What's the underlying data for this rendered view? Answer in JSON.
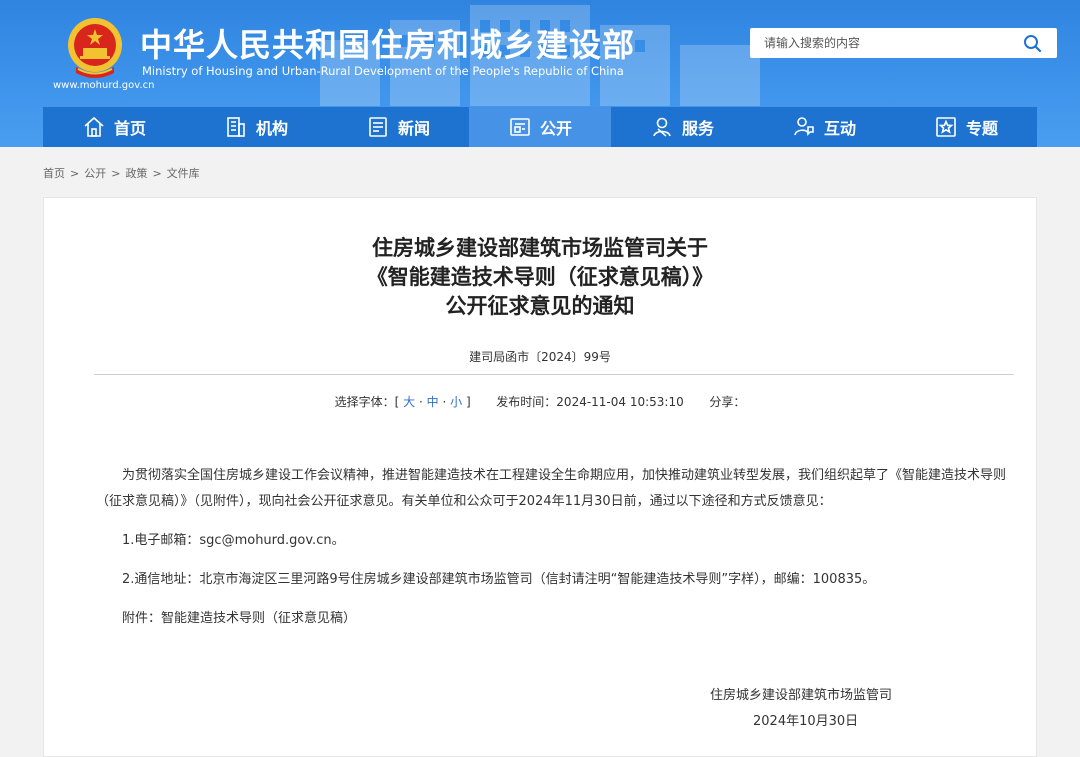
{
  "header": {
    "title": "中华人民共和国住房和城乡建设部",
    "subtitle": "Ministry of Housing and Urban-Rural Development of the People's Republic of China",
    "url": "www.mohurd.gov.cn",
    "search_placeholder": "请输入搜索的内容"
  },
  "nav": {
    "items": [
      {
        "label": "首页",
        "icon": "home-icon"
      },
      {
        "label": "机构",
        "icon": "building-icon"
      },
      {
        "label": "新闻",
        "icon": "newspaper-icon"
      },
      {
        "label": "公开",
        "icon": "open-info-icon",
        "active": true
      },
      {
        "label": "服务",
        "icon": "person-service-icon"
      },
      {
        "label": "互动",
        "icon": "interaction-icon"
      },
      {
        "label": "专题",
        "icon": "star-topic-icon"
      }
    ]
  },
  "breadcrumb": [
    "首页",
    "公开",
    "政策",
    "文件库"
  ],
  "article": {
    "title_lines": [
      "住房城乡建设部建筑市场监管司关于",
      "《智能建造技术导则（征求意见稿）》",
      "公开征求意见的通知"
    ],
    "doc_number": "建司局函市〔2024〕99号",
    "font_select_label": "选择字体：",
    "font_open": "[",
    "font_large": "大",
    "font_medium": "中",
    "font_small": "小",
    "font_dash": "·",
    "font_close": "]",
    "publish_label": "发布时间：",
    "publish_time": "2024-11-04 10:53:10",
    "share_label": "分享：",
    "paragraphs": [
      "为贯彻落实全国住房城乡建设工作会议精神，推进智能建造技术在工程建设全生命期应用，加快推动建筑业转型发展，我们组织起草了《智能建造技术导则（征求意见稿）》（见附件），现向社会公开征求意见。有关单位和公众可于2024年11月30日前，通过以下途径和方式反馈意见：",
      "1.电子邮箱：sgc@mohurd.gov.cn。",
      "2.通信地址：北京市海淀区三里河路9号住房城乡建设部建筑市场监管司（信封请注明“智能建造技术导则”字样），邮编：100835。",
      "附件：智能建造技术导则（征求意见稿）"
    ],
    "signer": "住房城乡建设部建筑市场监管司",
    "sign_date": "2024年10月30日"
  },
  "colors": {
    "header_blue": "#3d93ea",
    "nav_blue": "#1d73cf",
    "nav_active": "#4592e6",
    "emblem_red": "#d8261c",
    "emblem_gold": "#f2c230",
    "link_blue": "#2f6fc9"
  }
}
